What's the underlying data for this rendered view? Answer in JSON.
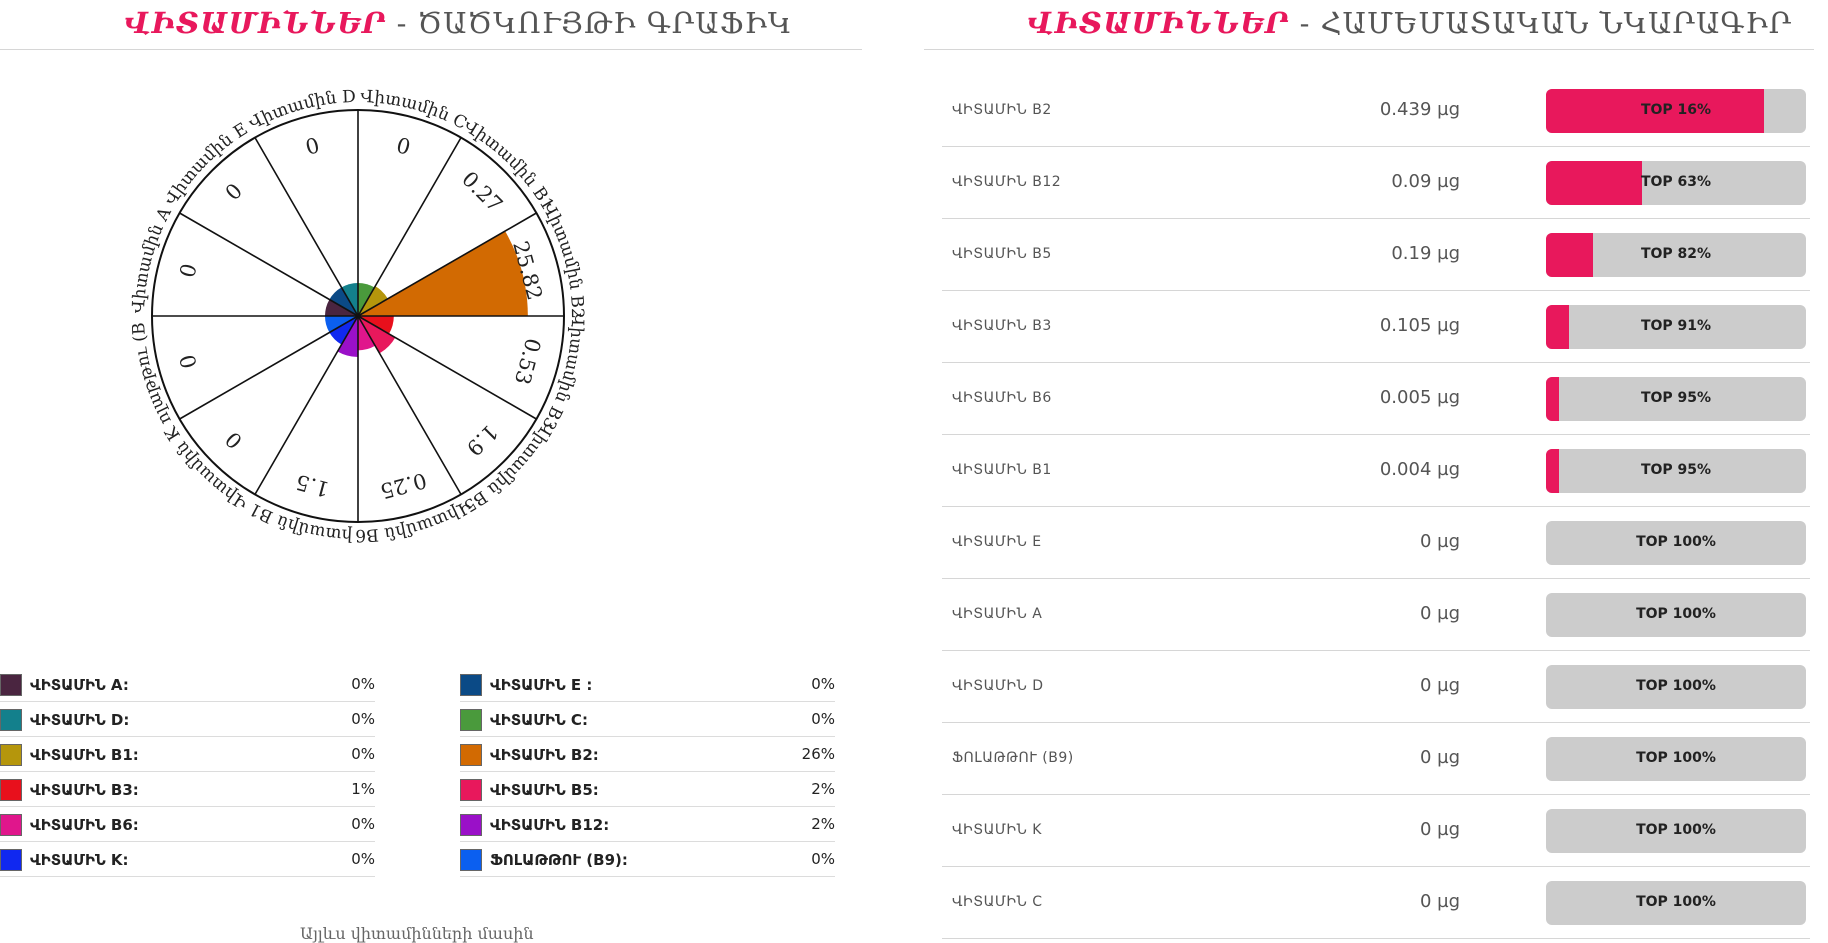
{
  "left_panel": {
    "title_accent": "ՎԻՏԱՄԻՆՆԵՐ",
    "title_sep": " - ",
    "title_rest": "ԾԱԾԿՈՒՅԹԻ ԳՐԱՖԻԿ",
    "footer_note": "Այլևս վիտամինների մասին"
  },
  "right_panel": {
    "title_accent": "ՎԻՏԱՄԻՆՆԵՐ",
    "title_sep": " - ",
    "title_rest": "ՀԱՄԵՄԱՏԱԿԱՆ ՆԿԱՐԱԳԻՐ"
  },
  "chart_data": [
    {
      "type": "polar-area",
      "categories": [
        "Վիտամին C",
        "Վիտամին B1",
        "Վիտամին B2",
        "Վիտամին B3",
        "Վիտամին B5",
        "Վիտամին B6",
        "Վիտամին B12",
        "Վիտամին K",
        "Ֆոլաթթու (B9)",
        "Վիտամին A",
        "Վիտամին E",
        "Վիտամին D"
      ],
      "value_labels": [
        "0",
        "0.27",
        "25.82",
        "0.53",
        "1.9",
        "0.25",
        "1.5",
        "0",
        "0",
        "0",
        "0",
        "0"
      ],
      "values": [
        0,
        0.27,
        25.82,
        0.53,
        1.9,
        0.25,
        1.5,
        0,
        0,
        0,
        0,
        0
      ],
      "colors": [
        "#4a9a3c",
        "#b5960c",
        "#d26a02",
        "#e8101c",
        "#e8185c",
        "#e0168c",
        "#9a10c8",
        "#1028f0",
        "#0b5ff0",
        "#4a2540",
        "#0b4a86",
        "#13808c"
      ],
      "max_value": 30
    },
    {
      "type": "bar",
      "categories": [
        "ՎԻՏԱՄԻՆ B2",
        "ՎԻՏԱՄԻՆ B12",
        "ՎԻՏԱՄԻՆ B5",
        "ՎԻՏԱՄԻՆ B3",
        "ՎԻՏԱՄԻՆ B6",
        "ՎԻՏԱՄԻՆ B1",
        "ՎԻՏԱՄԻՆ E",
        "ՎԻՏԱՄԻՆ A",
        "ՎԻՏԱՄԻՆ D",
        "ՖՈԼԱԹԹՈՒ (B9)",
        "ՎԻՏԱՄԻՆ K",
        "ՎԻՏԱՄԻՆ C"
      ],
      "values": [
        16,
        63,
        82,
        91,
        95,
        95,
        100,
        100,
        100,
        100,
        100,
        100
      ],
      "fill_fraction": [
        0.84,
        0.37,
        0.18,
        0.09,
        0.05,
        0.05,
        0,
        0,
        0,
        0,
        0,
        0
      ],
      "ylim": [
        0,
        100
      ]
    }
  ],
  "legend": {
    "left": [
      {
        "name": "ՎԻՏԱՄԻՆ A:",
        "pct": "0%",
        "color": "#4a2540"
      },
      {
        "name": "ՎԻՏԱՄԻՆ D:",
        "pct": "0%",
        "color": "#13808c"
      },
      {
        "name": "ՎԻՏԱՄԻՆ B1:",
        "pct": "0%",
        "color": "#b5960c"
      },
      {
        "name": "ՎԻՏԱՄԻՆ B3:",
        "pct": "1%",
        "color": "#e8101c"
      },
      {
        "name": "ՎԻՏԱՄԻՆ B6:",
        "pct": "0%",
        "color": "#e0168c"
      },
      {
        "name": "ՎԻՏԱՄԻՆ K:",
        "pct": "0%",
        "color": "#1028f0"
      }
    ],
    "right": [
      {
        "name": "ՎԻՏԱՄԻՆ E :",
        "pct": "0%",
        "color": "#0b4a86"
      },
      {
        "name": "ՎԻՏԱՄԻՆ C:",
        "pct": "0%",
        "color": "#4a9a3c"
      },
      {
        "name": "ՎԻՏԱՄԻՆ B2:",
        "pct": "26%",
        "color": "#d26a02"
      },
      {
        "name": "ՎԻՏԱՄԻՆ B5:",
        "pct": "2%",
        "color": "#e8185c"
      },
      {
        "name": "ՎԻՏԱՄԻՆ B12:",
        "pct": "2%",
        "color": "#9a10c8"
      },
      {
        "name": "ՖՈԼԱԹԹՈՒ (B9):",
        "pct": "0%",
        "color": "#0b5ff0"
      }
    ]
  },
  "vitamins_table": [
    {
      "name": "ՎԻՏԱՄԻՆ B2",
      "amount": "0.439 µg",
      "top": "TOP 16%"
    },
    {
      "name": "ՎԻՏԱՄԻՆ B12",
      "amount": "0.09 µg",
      "top": "TOP 63%"
    },
    {
      "name": "ՎԻՏԱՄԻՆ B5",
      "amount": "0.19 µg",
      "top": "TOP 82%"
    },
    {
      "name": "ՎԻՏԱՄԻՆ B3",
      "amount": "0.105 µg",
      "top": "TOP 91%"
    },
    {
      "name": "ՎԻՏԱՄԻՆ B6",
      "amount": "0.005 µg",
      "top": "TOP 95%"
    },
    {
      "name": "ՎԻՏԱՄԻՆ B1",
      "amount": "0.004 µg",
      "top": "TOP 95%"
    },
    {
      "name": "ՎԻՏԱՄԻՆ E",
      "amount": "0 µg",
      "top": "TOP 100%"
    },
    {
      "name": "ՎԻՏԱՄԻՆ A",
      "amount": "0 µg",
      "top": "TOP 100%"
    },
    {
      "name": "ՎԻՏԱՄԻՆ D",
      "amount": "0 µg",
      "top": "TOP 100%"
    },
    {
      "name": "ՖՈԼԱԹԹՈՒ (B9)",
      "amount": "0 µg",
      "top": "TOP 100%"
    },
    {
      "name": "ՎԻՏԱՄԻՆ K",
      "amount": "0 µg",
      "top": "TOP 100%"
    },
    {
      "name": "ՎԻՏԱՄԻՆ C",
      "amount": "0 µg",
      "top": "TOP 100%"
    }
  ],
  "colors": {
    "accent": "#e8185c",
    "bar_track": "#cccccc"
  }
}
